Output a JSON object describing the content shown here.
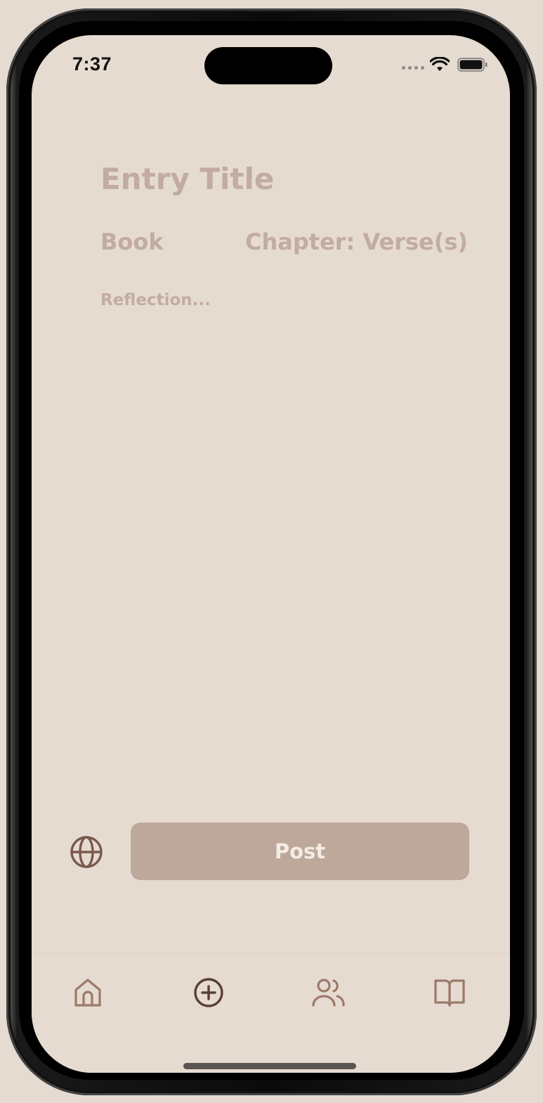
{
  "status_bar": {
    "time": "7:37"
  },
  "entry": {
    "title_placeholder": "Entry Title",
    "book_placeholder": "Book",
    "chapter_placeholder": "Chapter: Verse(s)",
    "reflection_placeholder": "Reflection..."
  },
  "actions": {
    "post_label": "Post",
    "visibility_icon": "globe-icon"
  },
  "tab_bar": {
    "items": [
      {
        "name": "home",
        "icon": "home-icon",
        "active": false
      },
      {
        "name": "new-entry",
        "icon": "plus-circle-icon",
        "active": true
      },
      {
        "name": "community",
        "icon": "people-icon",
        "active": false
      },
      {
        "name": "bible",
        "icon": "book-open-icon",
        "active": false
      }
    ]
  },
  "colors": {
    "background": "#e6dbd0",
    "placeholder_text": "#c2aba0",
    "button": "#bea89b",
    "button_text": "#f4ece6",
    "icon_inactive": "#9b7a6a",
    "icon_active": "#5a3f33"
  }
}
